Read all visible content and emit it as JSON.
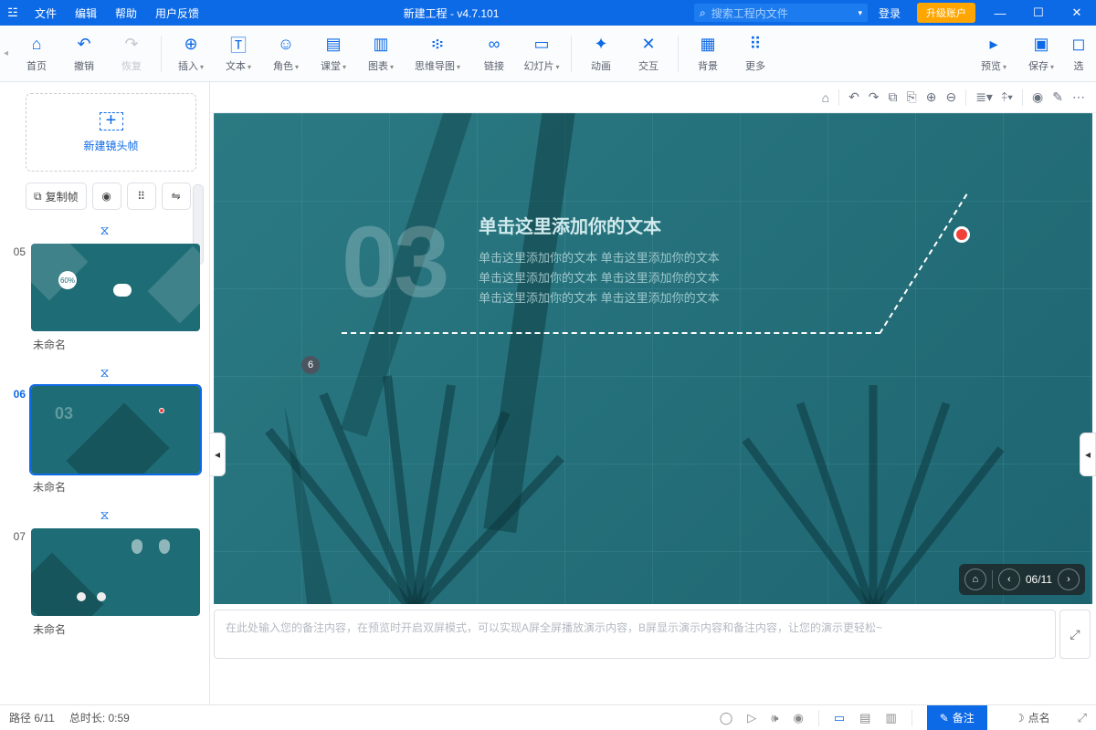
{
  "menu": {
    "file": "文件",
    "edit": "编辑",
    "help": "帮助",
    "feedback": "用户反馈"
  },
  "title": "新建工程  -  v4.7.101",
  "search": {
    "placeholder": "搜索工程内文件"
  },
  "account": {
    "login": "登录",
    "upgrade": "升级账户"
  },
  "toolbar": {
    "home": "首页",
    "undo": "撤销",
    "redo": "恢复",
    "insert": "插入",
    "text": "文本",
    "role": "角色",
    "class": "课堂",
    "chart": "图表",
    "mindmap": "思维导图",
    "link": "链接",
    "slide": "幻灯片",
    "anim": "动画",
    "interact": "交互",
    "bg": "背景",
    "more": "更多",
    "preview": "预览",
    "save": "保存",
    "select": "选"
  },
  "leftpane": {
    "newframe": "新建镜头帧",
    "copyframe": "复制帧",
    "thumbs": [
      {
        "num": "05",
        "caption": "未命名"
      },
      {
        "num": "06",
        "caption": "未命名"
      },
      {
        "num": "07",
        "caption": "未命名"
      }
    ]
  },
  "slide": {
    "bignum": "03",
    "title": "单击这里添加你的文本",
    "body1": "单击这里添加你的文本 单击这里添加你的文本",
    "body2": "单击这里添加你的文本 单击这里添加你的文本",
    "body3": "单击这里添加你的文本 单击这里添加你的文本",
    "badge": "6"
  },
  "nav": {
    "counter": "06/11"
  },
  "notes": {
    "placeholder": "在此处输入您的备注内容，在预览时开启双屏模式，可以实现A屏全屏播放演示内容，B屏显示演示内容和备注内容，让您的演示更轻松~"
  },
  "bottom": {
    "path": "路径 6/11",
    "duration": "总时长: 0:59",
    "tab_notes": "备注",
    "tab_roll": "点名"
  }
}
